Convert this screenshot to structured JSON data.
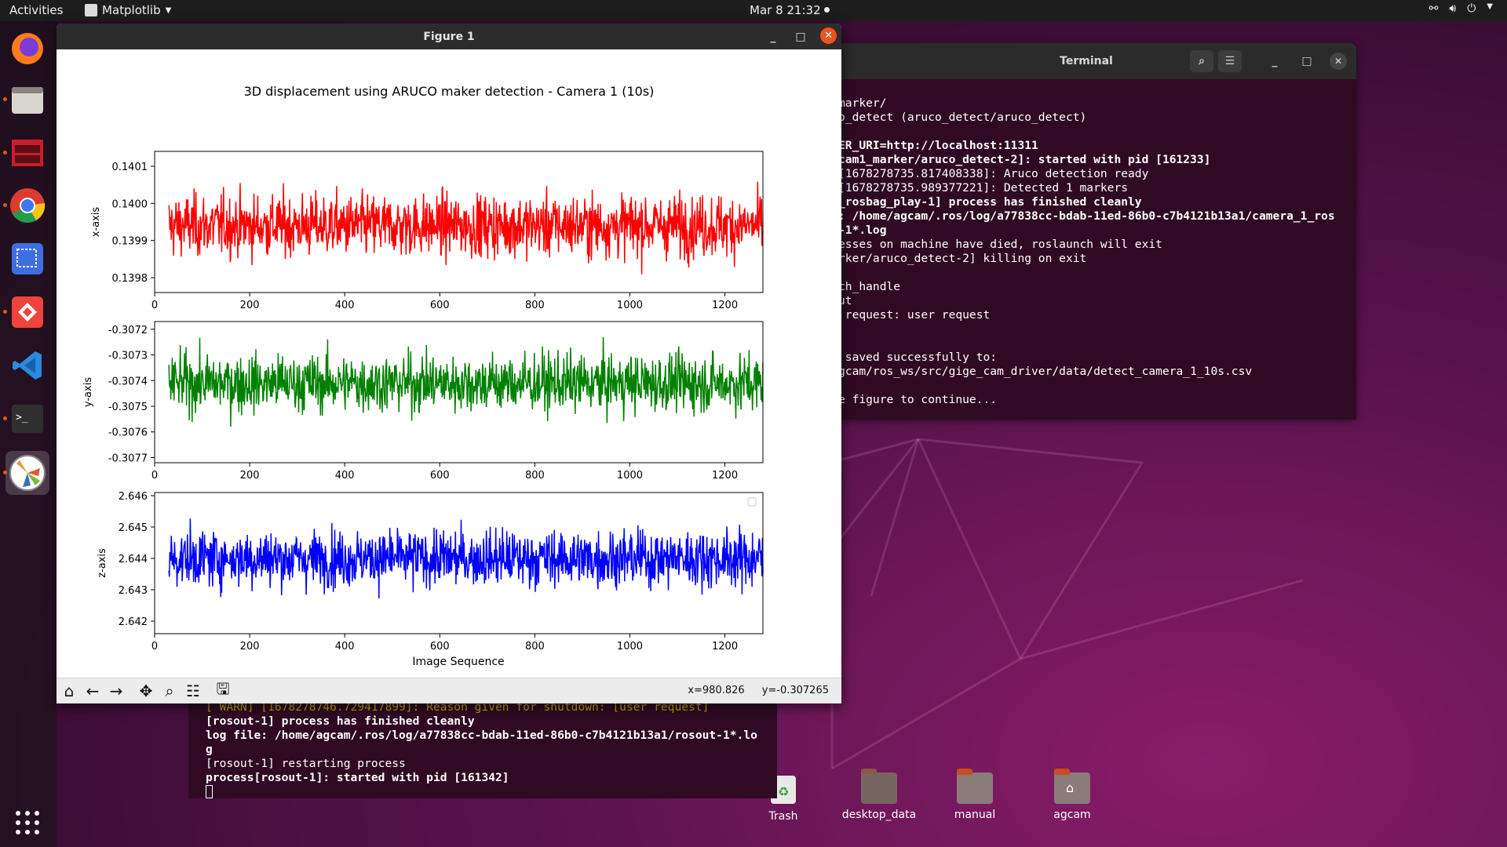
{
  "topbar": {
    "activities": "Activities",
    "app_menu": "Matplotlib",
    "clock": "Mar 8  21:32"
  },
  "terminal_back": {
    "title": "Terminal",
    "lines": [
      {
        "text": "marker/",
        "bold": false
      },
      {
        "text": "o_detect (aruco_detect/aruco_detect)",
        "bold": false
      },
      {
        "text": "",
        "bold": false
      },
      {
        "text": "ER_URI=http://localhost:11311",
        "bold": true
      },
      {
        "text": "cam1_marker/aruco_detect-2]: started with pid [161233]",
        "bold": true
      },
      {
        "text": "[1678278735.817408338]: Aruco detection ready",
        "bold": false
      },
      {
        "text": "[1678278735.989377221]: Detected 1 markers",
        "bold": false
      },
      {
        "text": "_rosbag_play-1] process has finished cleanly",
        "bold": true
      },
      {
        "text": ": /home/agcam/.ros/log/a77838cc-bdab-11ed-86b0-c7b4121b13a1/camera_1_ros",
        "bold": true
      },
      {
        "text": "-1*.log",
        "bold": true
      },
      {
        "text": "esses on machine have died, roslaunch will exit",
        "bold": false
      },
      {
        "text": "rker/aruco_detect-2] killing on exit",
        "bold": false
      },
      {
        "text": "",
        "bold": false
      },
      {
        "text": "ch_handle",
        "bold": false
      },
      {
        "text": "ut",
        "bold": false
      },
      {
        "text": " request: user request",
        "bold": false
      },
      {
        "text": "",
        "bold": false
      },
      {
        "text": "",
        "bold": false
      },
      {
        "text": " saved successfully to:",
        "bold": false
      },
      {
        "text": "gcam/ros_ws/src/gige_cam_driver/data/detect_camera_1_10s.csv",
        "bold": false
      },
      {
        "text": "",
        "bold": false
      },
      {
        "text": "e figure to continue...",
        "bold": false
      }
    ]
  },
  "terminal_bottom": {
    "warn_line": "[ WARN] [1678278746.729417899]: Reason given for shutdown: [user request]",
    "lines": [
      {
        "text": "[rosout-1] process has finished cleanly",
        "bold": true
      },
      {
        "text": "log file: /home/agcam/.ros/log/a77838cc-bdab-11ed-86b0-c7b4121b13a1/rosout-1*.lo",
        "bold": true
      },
      {
        "text": "g",
        "bold": true
      },
      {
        "text": "[rosout-1] restarting process",
        "bold": false
      },
      {
        "text": "process[rosout-1]: started with pid [161342]",
        "bold": true
      }
    ]
  },
  "desktop_icons": [
    {
      "label": "Trash"
    },
    {
      "label": "desktop_data"
    },
    {
      "label": "manual"
    },
    {
      "label": "agcam"
    }
  ],
  "figure_window": {
    "title": "Figure 1",
    "coords": {
      "x": "x=980.826",
      "y": "y=-0.307265"
    }
  },
  "chart_data": {
    "type": "line",
    "title": "3D displacement using ARUCO maker detection - Camera 1 (10s)",
    "xlabel": "Image Sequence",
    "xlim": [
      0,
      1280
    ],
    "x_range_data": [
      30,
      1280
    ],
    "xticks": [
      0,
      200,
      400,
      600,
      800,
      1000,
      1200
    ],
    "subplots": [
      {
        "ylabel": "x-axis",
        "color": "#ff0000",
        "ylim": [
          0.13976,
          0.14014
        ],
        "yticks": [
          "0.1401",
          "0.1400",
          "0.1399",
          "0.1398"
        ],
        "ytick_values": [
          0.1401,
          0.14,
          0.1399,
          0.1398
        ],
        "mean": 0.13994,
        "range": [
          0.13975,
          0.14012
        ]
      },
      {
        "ylabel": "y-axis",
        "color": "#008000",
        "ylim": [
          -0.30772,
          -0.30717
        ],
        "yticks": [
          "-0.3072",
          "-0.3073",
          "-0.3074",
          "-0.3075",
          "-0.3076",
          "-0.3077"
        ],
        "ytick_values": [
          -0.3072,
          -0.3073,
          -0.3074,
          -0.3075,
          -0.3076,
          -0.3077
        ],
        "mean": -0.30741,
        "range": [
          -0.30769,
          -0.30719
        ]
      },
      {
        "ylabel": "z-axis",
        "color": "#0000ff",
        "ylim": [
          2.6416,
          2.6461
        ],
        "yticks": [
          "2.646",
          "2.645",
          "2.644",
          "2.643",
          "2.642"
        ],
        "ytick_values": [
          2.646,
          2.645,
          2.644,
          2.643,
          2.642
        ],
        "mean": 2.644,
        "range": [
          2.6418,
          2.6458
        ]
      }
    ]
  }
}
